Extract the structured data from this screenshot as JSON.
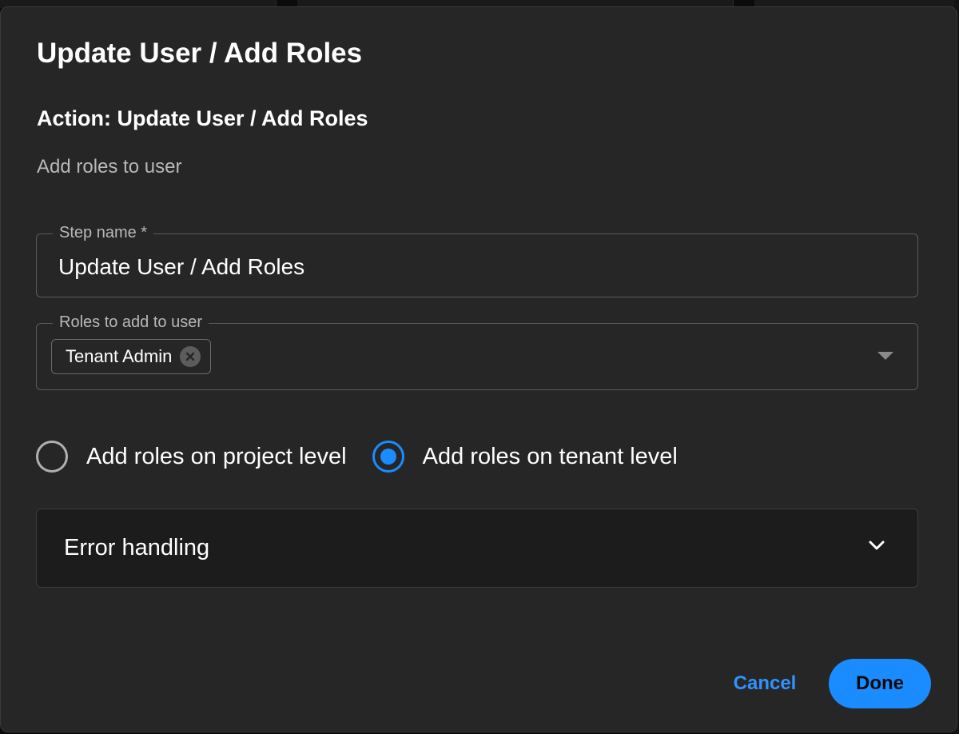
{
  "dialog": {
    "title": "Update User / Add Roles",
    "action_heading": "Action: Update User / Add Roles",
    "description": "Add roles to user"
  },
  "step_name": {
    "label": "Step name *",
    "value": "Update User / Add Roles"
  },
  "roles": {
    "label": "Roles to add to user",
    "selected": [
      {
        "label": "Tenant Admin"
      }
    ]
  },
  "role_level": {
    "options": [
      {
        "label": "Add roles on project level",
        "checked": false
      },
      {
        "label": "Add roles on tenant level",
        "checked": true
      }
    ]
  },
  "error_handling": {
    "label": "Error handling",
    "expanded": false
  },
  "footer": {
    "cancel_label": "Cancel",
    "done_label": "Done"
  },
  "colors": {
    "accent": "#1a8cff",
    "dialog_background": "#262626",
    "accordion_background": "#1c1c1c"
  },
  "icons": {
    "chip_remove": "close-circle-icon",
    "dropdown": "caret-down-icon",
    "accordion": "chevron-down-icon"
  }
}
